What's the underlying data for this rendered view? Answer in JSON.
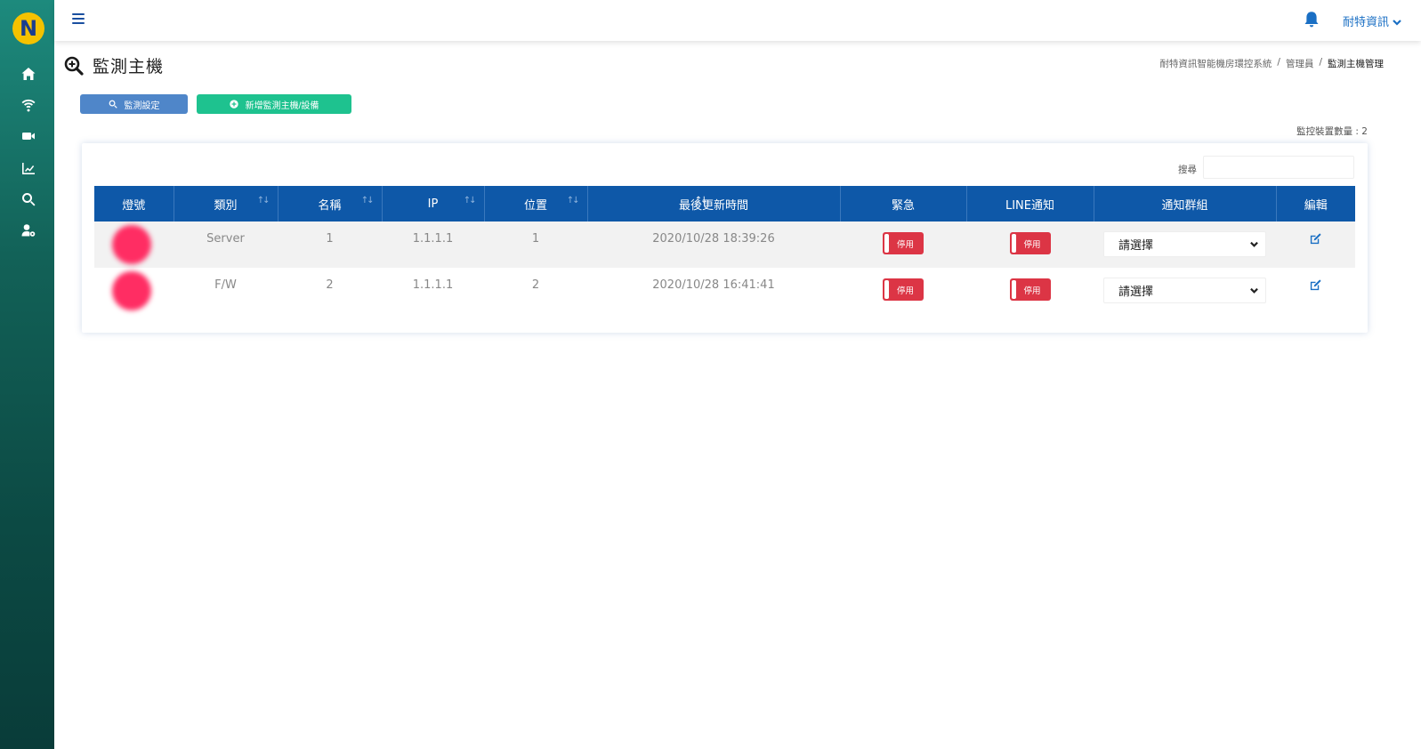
{
  "sidebar": {
    "logo_letter": "N",
    "items": [
      {
        "icon": "home-icon"
      },
      {
        "icon": "wifi-icon"
      },
      {
        "icon": "video-icon"
      },
      {
        "icon": "chart-line-icon"
      },
      {
        "icon": "search-icon"
      },
      {
        "icon": "user-settings-icon"
      }
    ]
  },
  "topbar": {
    "user_name": "耐特資訊"
  },
  "page": {
    "title": "監測主機",
    "breadcrumb": [
      "耐特資訊智能機房環控系統",
      "管理員",
      "監測主機管理"
    ]
  },
  "toolbar": {
    "setting_label": "監測設定",
    "add_label": "新增監測主機/設備"
  },
  "device_count": "監控裝置數量 : 2",
  "search": {
    "label": "搜尋",
    "value": ""
  },
  "table": {
    "headers": [
      "燈號",
      "類別",
      "名稱",
      "IP",
      "位置",
      "最後更新時間",
      "緊急",
      "LINE通知",
      "通知群組",
      "編輯"
    ],
    "rows": [
      {
        "category": "Server",
        "name": "1",
        "ip": "1.1.1.1",
        "location": "1",
        "updated": "2020/10/28 18:39:26",
        "urgent": "停用",
        "line": "停用",
        "group": "請選擇"
      },
      {
        "category": "F/W",
        "name": "2",
        "ip": "1.1.1.1",
        "location": "2",
        "updated": "2020/10/28 16:41:41",
        "urgent": "停用",
        "line": "停用",
        "group": "請選擇"
      }
    ]
  },
  "colors": {
    "header_bg": "#0e58a8",
    "toggle_off": "#dc3545",
    "lamp": "#ff2d63",
    "btn_setting": "#4f86c9",
    "btn_add": "#1ec28f"
  }
}
